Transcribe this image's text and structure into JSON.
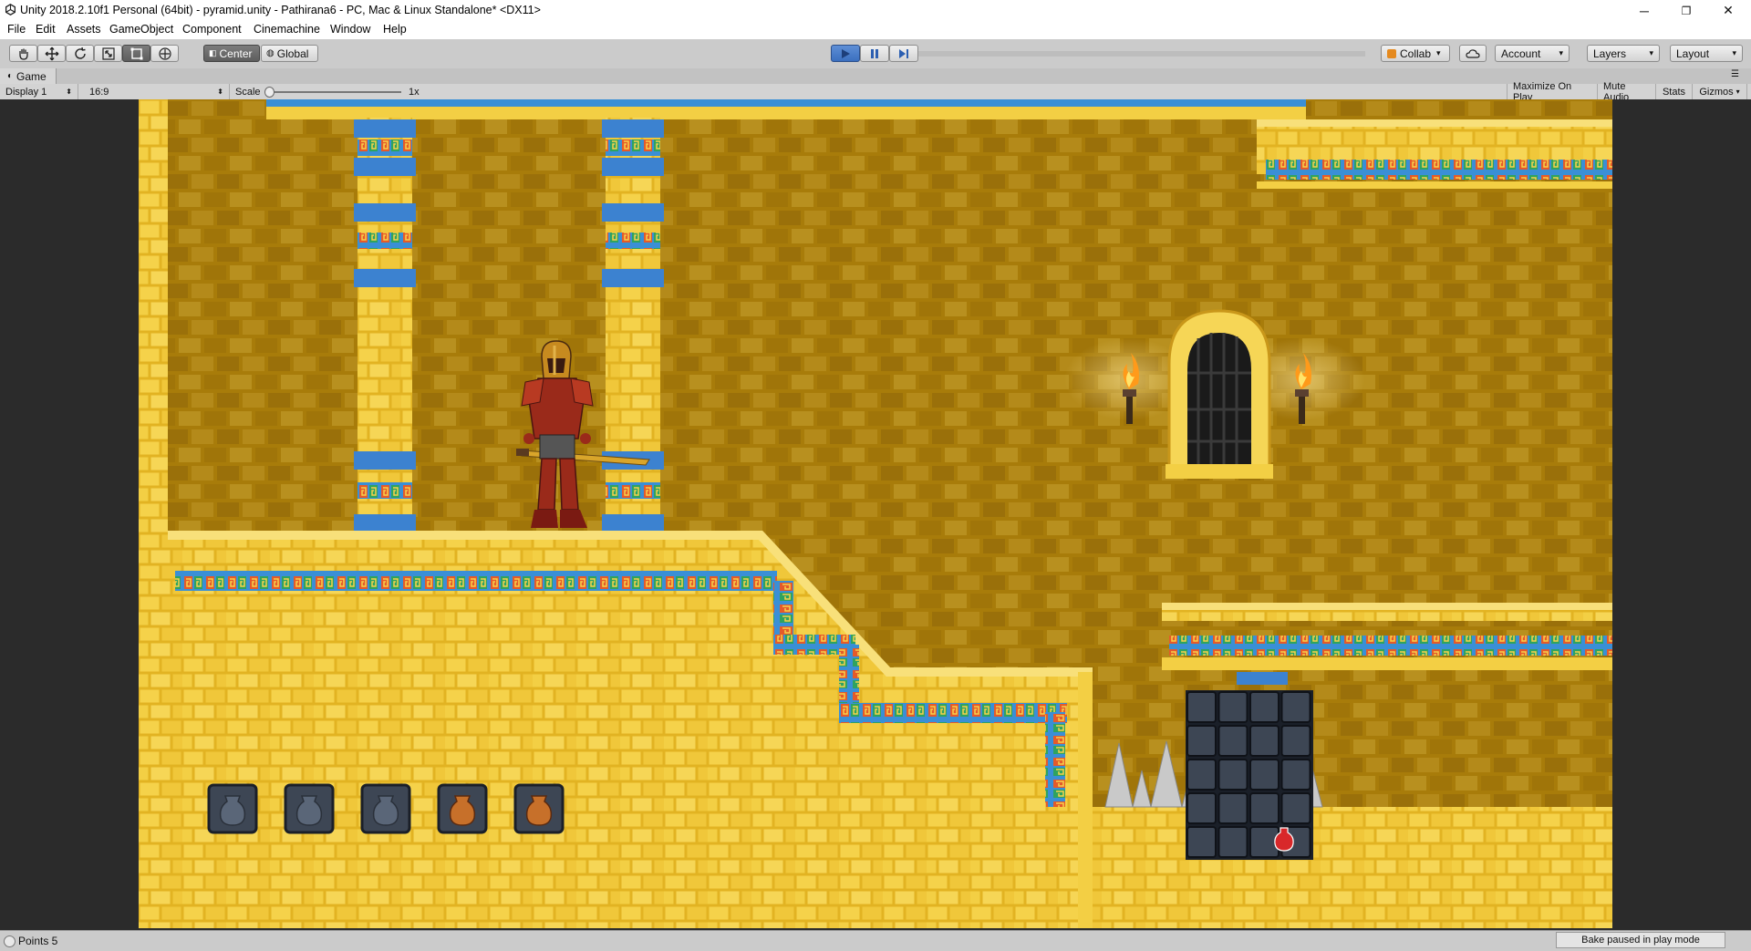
{
  "window": {
    "title": "Unity 2018.2.10f1 Personal (64bit) - pyramid.unity - Pathirana6 - PC, Mac & Linux Standalone* <DX11>",
    "minimize": "─",
    "restore": "❐",
    "close": "✕"
  },
  "menu": [
    "File",
    "Edit",
    "Assets",
    "GameObject",
    "Component",
    "Cinemachine",
    "Window",
    "Help"
  ],
  "toolbar": {
    "pivot_label": "Center",
    "space_label": "Global",
    "collab_label": "Collab",
    "account_label": "Account",
    "layers_label": "Layers",
    "layout_label": "Layout"
  },
  "game_tab": {
    "title": "Game",
    "display": "Display 1",
    "aspect": "16:9",
    "scale_label": "Scale",
    "scale_value": "1x",
    "maximize_on_play": "Maximize On Play",
    "mute_audio": "Mute Audio",
    "stats": "Stats",
    "gizmos": "Gizmos"
  },
  "status": {
    "message": "Points 5",
    "bake": "Bake paused in play mode"
  },
  "colors": {
    "wall_dark": "#a87c0a",
    "wall_light": "#f0c73a",
    "pillar_blue": "#3c82d0",
    "slot_dark": "#3d4654"
  }
}
